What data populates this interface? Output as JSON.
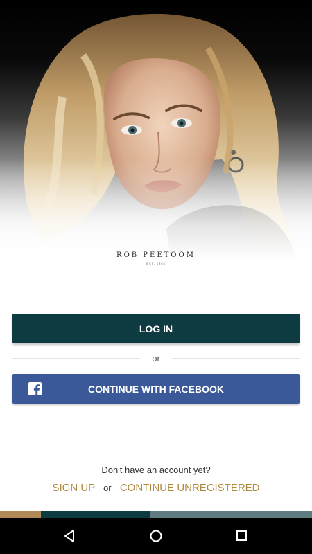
{
  "brand": {
    "name": "ROB PEETOOM",
    "established": "EST. 1965"
  },
  "buttons": {
    "login_label": "LOG IN",
    "facebook_label": "CONTINUE WITH FACEBOOK"
  },
  "divider": {
    "or_label": "or"
  },
  "footer": {
    "prompt": "Don't have an account yet?",
    "signup_label": "SIGN UP",
    "or_label": "or",
    "unregistered_label": "CONTINUE UNREGISTERED"
  },
  "colors": {
    "login_button": "#0d3b41",
    "facebook_button": "#3b5998",
    "link_gold": "#b08a3e",
    "bar_gold": "#b08a57",
    "bar_teal": "#0d3b41",
    "bar_slate": "#5f7b80"
  },
  "icons": {
    "facebook": "facebook-icon",
    "back": "back-triangle-icon",
    "home": "home-circle-icon",
    "recents": "recents-square-icon"
  }
}
